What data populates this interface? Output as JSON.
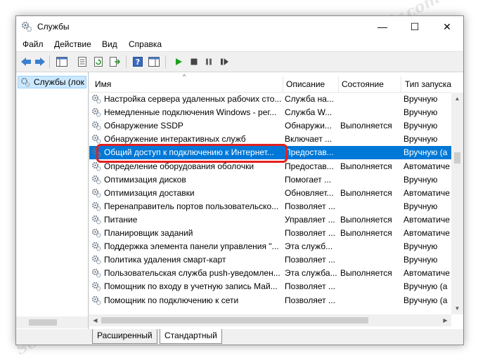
{
  "window": {
    "title": "Службы",
    "controls": {
      "minimize": "—",
      "maximize": "☐",
      "close": "✕"
    }
  },
  "menu": [
    "Файл",
    "Действие",
    "Вид",
    "Справка"
  ],
  "toolbar": {
    "icons": [
      "back-arrow-icon",
      "forward-arrow-icon",
      "console-tree-icon",
      "properties-icon",
      "refresh-icon",
      "export-list-icon",
      "help-icon",
      "action-pane-icon",
      "start-service-icon",
      "stop-service-icon",
      "pause-service-icon",
      "restart-service-icon"
    ]
  },
  "left_pane": {
    "item": "Службы (лок"
  },
  "columns": {
    "name": "Имя",
    "desc": "Описание",
    "state": "Состояние",
    "start": "Тип запуска"
  },
  "rows": [
    {
      "name": "Настройка сервера удаленных рабочих сто...",
      "desc": "Служба на...",
      "state": "",
      "start": "Вручную"
    },
    {
      "name": "Немедленные подключения Windows - рег...",
      "desc": "Служба W...",
      "state": "",
      "start": "Вручную"
    },
    {
      "name": "Обнаружение SSDP",
      "desc": "Обнаружи...",
      "state": "Выполняется",
      "start": "Вручную"
    },
    {
      "name": "Обнаружение интерактивных служб",
      "desc": "Включает ...",
      "state": "",
      "start": "Вручную"
    },
    {
      "name": "Общий доступ к подключению к Интернет...",
      "desc": "Предостав...",
      "state": "",
      "start": "Вручную (а"
    },
    {
      "name": "Определение оборудования оболочки",
      "desc": "Предостав...",
      "state": "Выполняется",
      "start": "Автоматиче"
    },
    {
      "name": "Оптимизация дисков",
      "desc": "Помогает ...",
      "state": "",
      "start": "Вручную"
    },
    {
      "name": "Оптимизация доставки",
      "desc": "Обновляет...",
      "state": "Выполняется",
      "start": "Автоматиче"
    },
    {
      "name": "Перенаправитель портов пользовательско...",
      "desc": "Позволяет ...",
      "state": "",
      "start": "Вручную"
    },
    {
      "name": "Питание",
      "desc": "Управляет ...",
      "state": "Выполняется",
      "start": "Автоматиче"
    },
    {
      "name": "Планировщик заданий",
      "desc": "Позволяет ...",
      "state": "Выполняется",
      "start": "Автоматиче"
    },
    {
      "name": "Поддержка элемента панели управления \"...",
      "desc": "Эта служб...",
      "state": "",
      "start": "Вручную"
    },
    {
      "name": "Политика удаления смарт-карт",
      "desc": "Позволяет ...",
      "state": "",
      "start": "Вручную"
    },
    {
      "name": "Пользовательская служба push-уведомлен...",
      "desc": "Эта служба...",
      "state": "Выполняется",
      "start": "Автоматиче"
    },
    {
      "name": "Помощник по входу в учетную запись Май...",
      "desc": "Позволяет ...",
      "state": "",
      "start": "Вручную (а"
    },
    {
      "name": "Помощник по подключению к сети",
      "desc": "Позволяет ...",
      "state": "",
      "start": "Вручную (а"
    }
  ],
  "selected_row": 4,
  "tabs": [
    "Расширенный",
    "Стандартный"
  ],
  "active_tab": 1,
  "watermark": "Soringpcrepair.com",
  "colors": {
    "selection": "#0078d7",
    "highlight_frame": "#e02020"
  }
}
